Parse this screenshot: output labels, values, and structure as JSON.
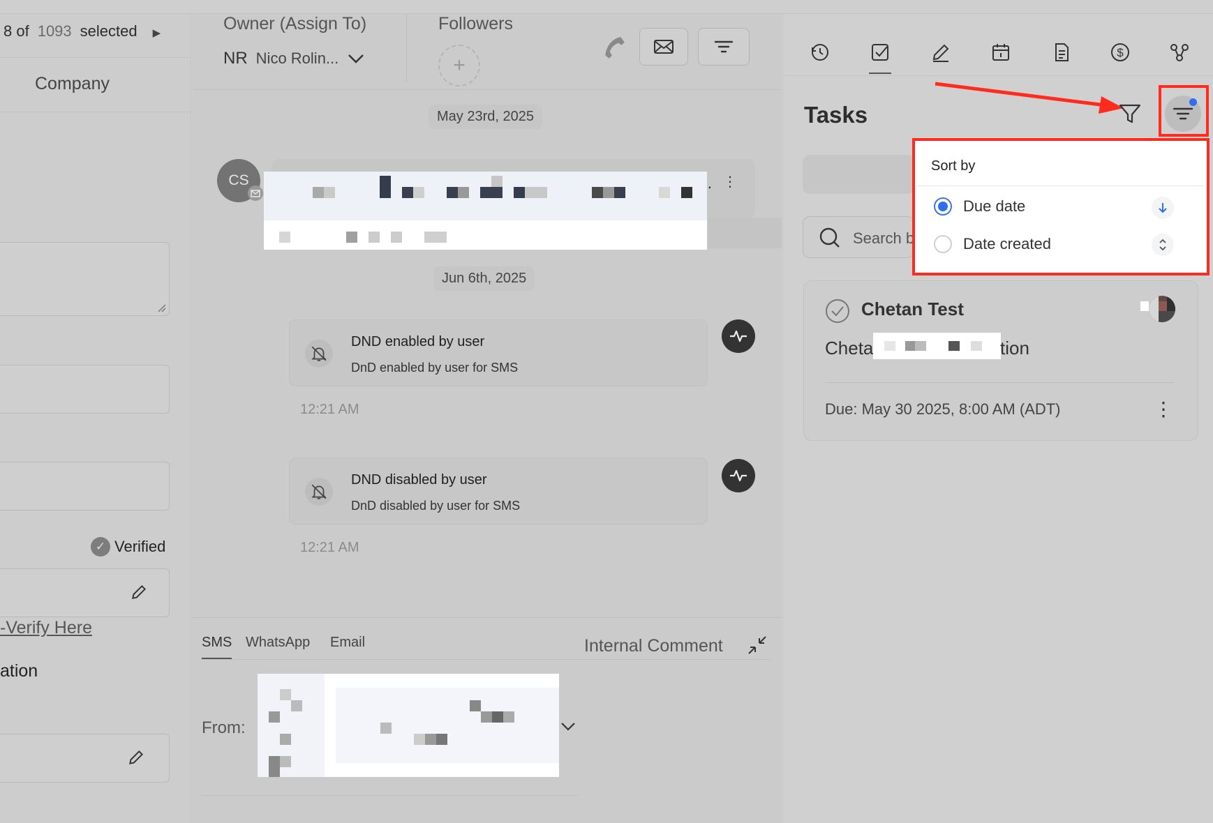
{
  "left": {
    "selection": {
      "prefix": "8 of",
      "total": "1093",
      "suffix": "selected"
    },
    "company_label": "Company",
    "verified_label": "Verified",
    "verify_link": "-Verify Here",
    "truncated_label": "ation"
  },
  "middle": {
    "owner_label": "Owner (Assign To)",
    "owner_initials": "NR",
    "owner_name": "Nico Rolin...",
    "followers_label": "Followers",
    "dates": [
      "May 23rd, 2025",
      "Jun 6th, 2025"
    ],
    "avatar_initials": "CS",
    "events": [
      {
        "title": "DND enabled by user",
        "subtitle": "DnD enabled by user for SMS",
        "time": "12:21 AM"
      },
      {
        "title": "DND disabled by user",
        "subtitle": "DnD disabled by user for SMS",
        "time": "12:21 AM"
      }
    ],
    "ellipsis": "...",
    "compose_tabs": [
      "SMS",
      "WhatsApp",
      "Email"
    ],
    "internal_comment": "Internal Comment",
    "from_label": "From:"
  },
  "right": {
    "title": "Tasks",
    "search_placeholder": "Search b",
    "sort_menu": {
      "heading": "Sort by",
      "options": [
        {
          "label": "Due date",
          "selected": true
        },
        {
          "label": "Date created",
          "selected": false
        }
      ]
    },
    "task": {
      "title": "Chetan Test",
      "desc_start": "Cheta",
      "desc_end": "tion",
      "due": "Due: May 30 2025, 8:00 AM (ADT)"
    }
  },
  "colors": {
    "accent": "#2f6fef",
    "highlight": "#ff2b1f"
  },
  "icons": [
    "clock-icon",
    "task-check-icon",
    "pen-icon",
    "calendar-icon",
    "document-icon",
    "dollar-icon",
    "workflow-icon",
    "filter-icon",
    "sort-icon"
  ]
}
